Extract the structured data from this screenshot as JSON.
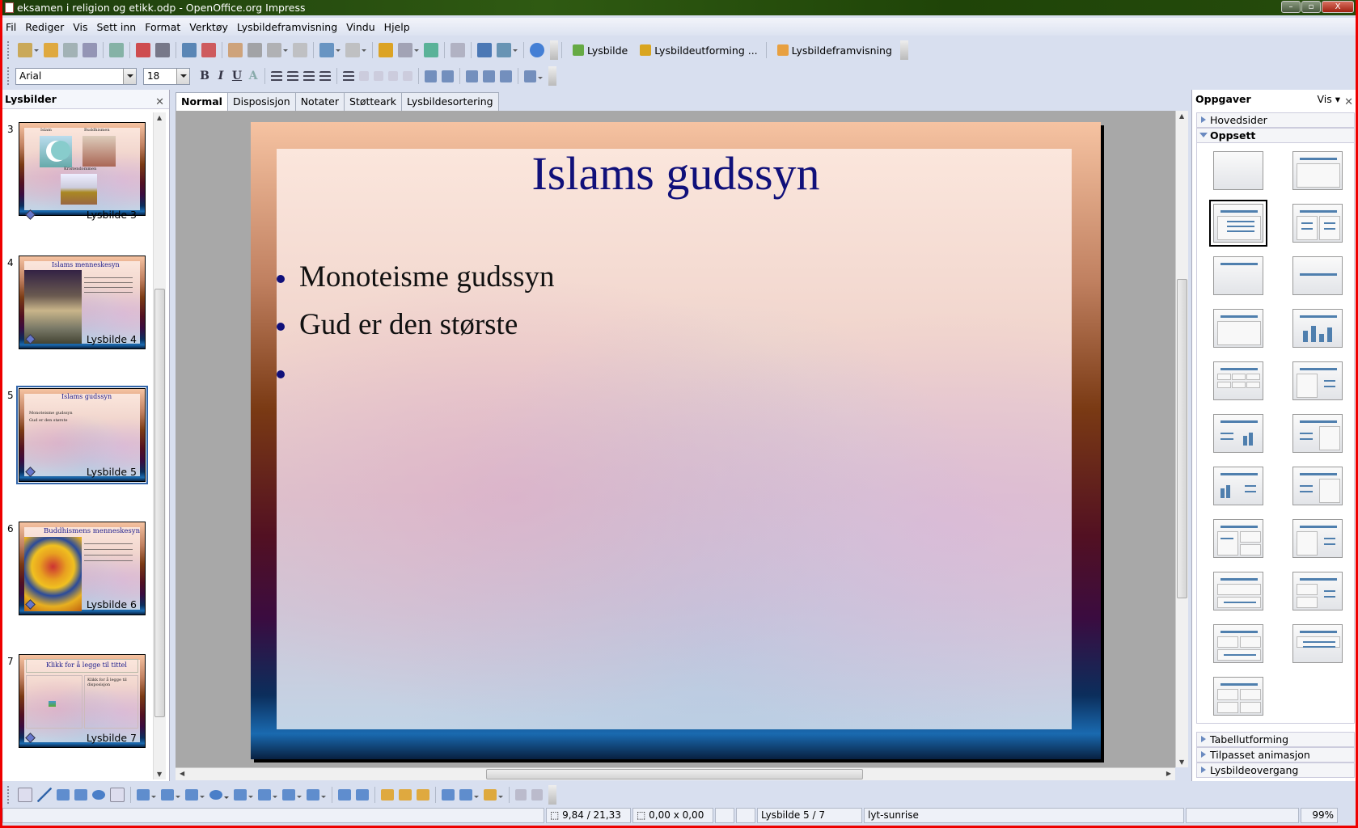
{
  "window": {
    "title": "eksamen i religion og etikk.odp - OpenOffice.org Impress"
  },
  "menu": [
    "Fil",
    "Rediger",
    "Vis",
    "Sett inn",
    "Format",
    "Verktøy",
    "Lysbildeframvisning",
    "Vindu",
    "Hjelp"
  ],
  "toolbar1": {
    "icons_a": [
      "new-document-icon",
      "open-folder-icon",
      "save-icon",
      "email-icon",
      "edit-mode-icon",
      "export-pdf-icon",
      "print-icon",
      "spellcheck-icon",
      "autospellcheck-icon",
      "cut-icon",
      "copy-icon",
      "paste-icon",
      "format-paintbrush-icon",
      "undo-icon",
      "redo-icon",
      "chart-icon",
      "table-icon",
      "hyperlink-globe-icon",
      "grid-icon",
      "navigator-icon",
      "zoom-icon",
      "help-icon"
    ],
    "slide_label": "Lysbilde",
    "design_label": "Lysbildeutforming ...",
    "show_label": "Lysbildeframvisning"
  },
  "toolbar2": {
    "font_name": "Arial",
    "font_size": "18",
    "format_labels": [
      "B",
      "I",
      "U",
      "A"
    ]
  },
  "slides_panel": {
    "title": "Lysbilder",
    "slides": [
      {
        "num": "3",
        "label": "Lysbilde 3",
        "bullets": [
          "Islam",
          "Buddhismen",
          "Kristendommen"
        ]
      },
      {
        "num": "4",
        "label": "Lysbilde 4",
        "title": "Islams menneskesyn"
      },
      {
        "num": "5",
        "label": "Lysbilde 5",
        "title": "Islams gudssyn",
        "bullets": [
          "Monoteisme gudssyn",
          "Gud er den største"
        ]
      },
      {
        "num": "6",
        "label": "Lysbilde 6",
        "title": "Buddhismens menneskesyn"
      },
      {
        "num": "7",
        "label": "Lysbilde 7",
        "title": "Klikk for å legge til tittel",
        "right_text": "Klikk for å legge til disposisjon"
      }
    ]
  },
  "view_tabs": [
    {
      "label": "Normal",
      "active": true
    },
    {
      "label": "Disposisjon"
    },
    {
      "label": "Notater"
    },
    {
      "label": "Støtteark"
    },
    {
      "label": "Lysbildesortering"
    }
  ],
  "slide": {
    "title": "Islams gudssyn",
    "bullets": [
      "Monoteisme gudssyn",
      "Gud er den største",
      ""
    ]
  },
  "tasks_panel": {
    "title": "Oppgaver",
    "view_label": "Vis",
    "sections_top": [
      "Hovedsider",
      "Oppsett"
    ],
    "sections_bottom": [
      "Tabellutforming",
      "Tilpasset animasjon",
      "Lysbildeovergang"
    ],
    "layouts": [
      "blank",
      "title-only-centered",
      "title-content",
      "title-2-content",
      "title-only",
      "centered-text",
      "title-content-box",
      "title-chart",
      "title-table",
      "title-clipart-text",
      "title-text-chart",
      "title-text-clipart",
      "title-chart-text",
      "title-text-box",
      "title-2-content-over",
      "title-content-2",
      "title-2-stacked",
      "title-2-content-right",
      "title-text-over",
      "title-content-over-2",
      "title-4-content"
    ],
    "selected_layout": 2
  },
  "draw_toolbar": [
    "select-arrow-icon",
    "line-icon",
    "arrow-line-icon",
    "rectangle-icon",
    "ellipse-icon",
    "text-icon",
    "curve-icon",
    "connector-icon",
    "basic-shapes-icon",
    "symbol-shapes-icon",
    "block-arrows-icon",
    "flowchart-icon",
    "callouts-icon",
    "stars-icon",
    "points-icon",
    "glue-points-icon",
    "fontwork-icon",
    "from-file-icon",
    "gallery-icon",
    "rotate-icon",
    "alignment-icon",
    "arrange-icon",
    "extrusion-icon",
    "extrusion-tilt-icon"
  ],
  "status": {
    "position": "9,84 / 21,33",
    "size": "0,00 x 0,00",
    "slide": "Lysbilde 5 / 7",
    "master": "lyt-sunrise",
    "zoom": "99%"
  }
}
